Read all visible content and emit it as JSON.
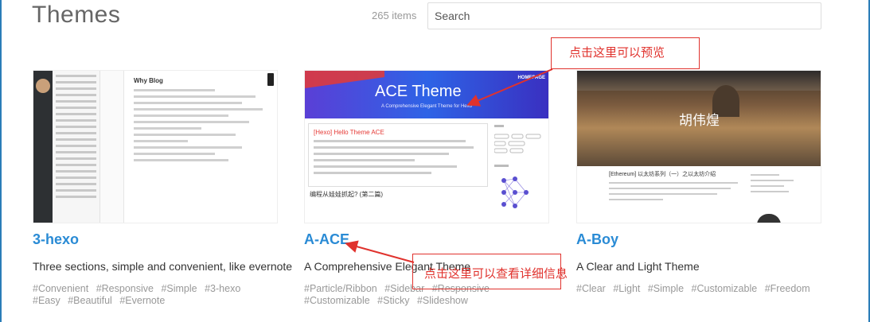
{
  "header": {
    "title": "Themes",
    "count": "265 items",
    "search_placeholder": "Search"
  },
  "themes": [
    {
      "title": "3-hexo",
      "description": "Three sections, simple and convenient, like evernote",
      "tags": [
        "#Convenient",
        "#Responsive",
        "#Simple",
        "#3-hexo",
        "#Easy",
        "#Beautiful",
        "#Evernote"
      ],
      "preview": {
        "heading": "Why Blog"
      }
    },
    {
      "title": "A-ACE",
      "description": "A Comprehensive Elegant Theme",
      "tags": [
        "#Particle/Ribbon",
        "#Sidebar",
        "#Responsive",
        "#Customizable",
        "#Sticky",
        "#Slideshow"
      ],
      "preview": {
        "banner_title": "ACE Theme",
        "banner_subtitle": "A Comprehensive Elegant Theme for Hexo",
        "nav": "HOMEPAGE",
        "post_title": "[Hexo] Hello Theme ACE",
        "post2_title": "编程从娃娃抓起? (第二篇)"
      }
    },
    {
      "title": "A-Boy",
      "description": "A Clear and Light Theme",
      "tags": [
        "#Clear",
        "#Light",
        "#Simple",
        "#Customizable",
        "#Freedom"
      ],
      "preview": {
        "hero_name": "胡伟煌",
        "post_title": "[Ethereum] 以太坊系列（一）之以太坊介绍"
      }
    }
  ],
  "annotations": {
    "preview_note": "点击这里可以预览",
    "detail_note": "点击这里可以查看详细信息"
  },
  "colors": {
    "link": "#2a8bd5",
    "annotation": "#e0322d",
    "tag": "#999999"
  }
}
